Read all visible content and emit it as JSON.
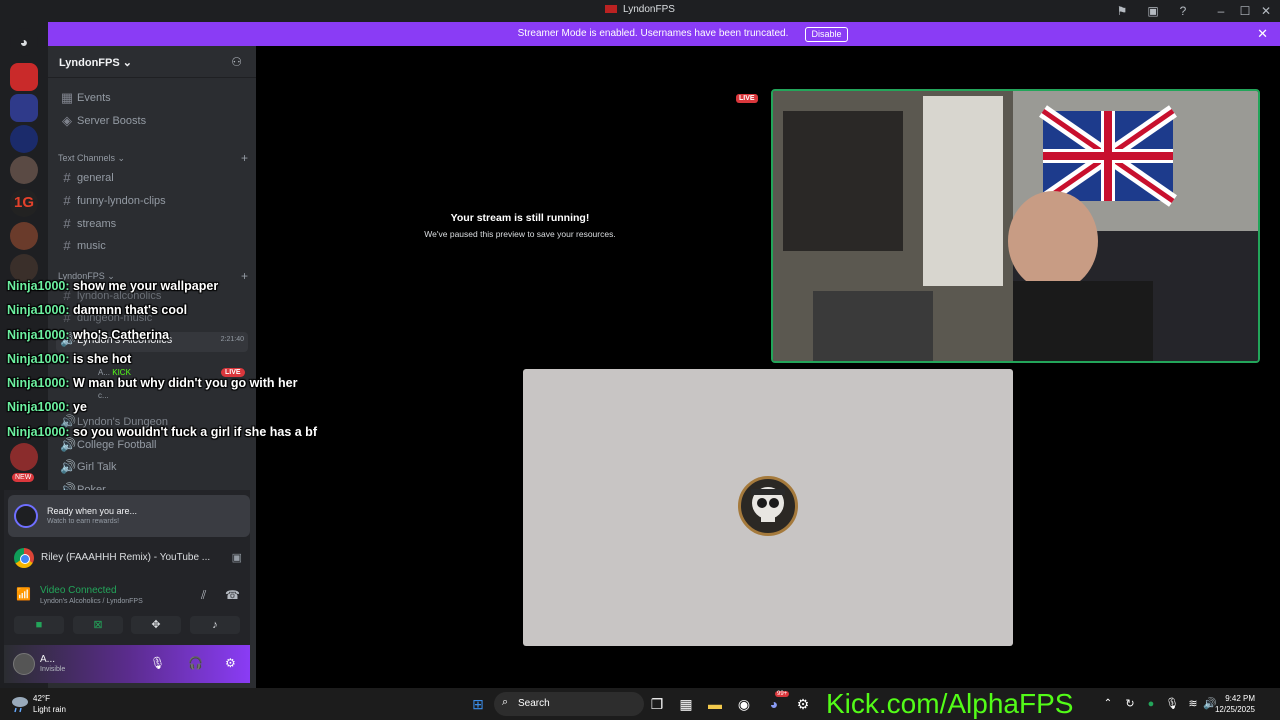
{
  "window": {
    "title": "LyndonFPS"
  },
  "streamer_bar": {
    "message": "Streamer Mode is enabled. Usernames have been truncated.",
    "disable_label": "Disable"
  },
  "server": {
    "name": "LyndonFPS ⌄"
  },
  "top_items": [
    {
      "label": "Events",
      "icon": "calendar-icon"
    },
    {
      "label": "Server Boosts",
      "icon": "boost-icon"
    }
  ],
  "text_category": {
    "label": "Text Channels ⌄"
  },
  "text_channels": [
    "general",
    "funny-lyndon-clips",
    "streams",
    "music"
  ],
  "lyndon_category": {
    "label": "LyndonFPS ⌄"
  },
  "hidden_channels": [
    "lyndon-alcoholics",
    "dungeon-music"
  ],
  "voice_channel": {
    "name": "Lyndon's Alcoholics",
    "time": "2:21:40"
  },
  "voice_users": [
    {
      "name": "A...",
      "extra": "KICK",
      "live": "LIVE"
    },
    {
      "name": "c..."
    }
  ],
  "voice_channels": [
    "Lyndon's Dungeon",
    "College Football",
    "Girl Talk",
    "Poker"
  ],
  "overlay_chat": [
    {
      "user": "Ninja1000:",
      "text": " show me your wallpaper"
    },
    {
      "user": "Ninja1000:",
      "text": " damnnn that's cool"
    },
    {
      "user": "Ninja1000:",
      "text": " who's Catherina"
    },
    {
      "user": "Ninja1000:",
      "text": " is she hot"
    },
    {
      "user": "Ninja1000:",
      "text": " W man but why didn't you go with her"
    },
    {
      "user": "Ninja1000:",
      "text": " ye"
    },
    {
      "user": "Ninja1000:",
      "text": " so you wouldn't fuck a girl if she has a bf"
    }
  ],
  "guild_badge_new": "NEW",
  "ready_card": {
    "title": "Ready when you are...",
    "subtitle": "Watch to earn rewards!"
  },
  "activity": {
    "label": "Riley (FAAAHHH Remix) - YouTube ..."
  },
  "voice_status": {
    "title": "Video Connected",
    "subtitle": "Lyndon's Alcoholics / LyndonFPS"
  },
  "user": {
    "name": "A...",
    "status": "Invisible"
  },
  "stream": {
    "live_label": "LIVE",
    "paused_title": "Your stream is still running!",
    "paused_subtitle": "We've paused this preview to save your resources."
  },
  "taskbar": {
    "temp": "42°F",
    "condition": "Light rain",
    "search_label": "Search",
    "time": "9:42 PM",
    "date": "12/25/2025",
    "badge_count": "99+"
  },
  "kick_text": "Kick.com/AlphaFPS",
  "colors": {
    "accent": "#8a3cf5",
    "online": "#23a55a",
    "live": "#da373c",
    "kick_green": "#53fc18"
  }
}
